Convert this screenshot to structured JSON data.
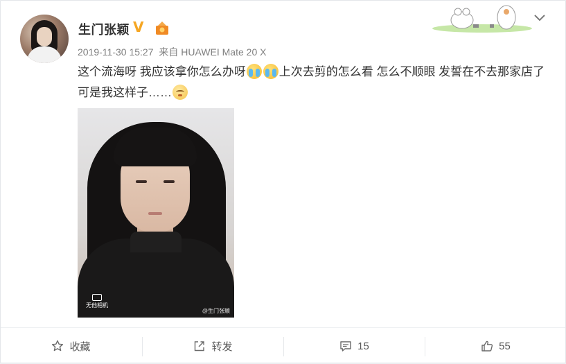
{
  "post": {
    "username": "生门张颖",
    "verified_mark": "V",
    "timestamp": "2019-11-30 15:27",
    "source": "来自 HUAWEI Mate 20 X",
    "text_part1": "这个流海呀 我应该拿你怎么办呀",
    "text_part2": "上次去剪的怎么看 怎么不顺眼 发誓在不去那家店了 可是我这样子……",
    "emojis": [
      "cry-emoji",
      "cry-emoji",
      "dizzy-emoji"
    ],
    "photo_camera_label": "无他相机",
    "photo_watermark": "@生门张颖"
  },
  "actions": {
    "favorite_label": "收藏",
    "repost_label": "转发",
    "comment_count": "15",
    "like_count": "55"
  },
  "colors": {
    "verified": "#f5a623",
    "meta_gray": "#808080",
    "text": "#333333"
  },
  "icons": {
    "favorite": "star-icon",
    "repost": "share-icon",
    "comment": "comment-icon",
    "like": "thumbs-up-icon",
    "menu": "chevron-down-icon"
  }
}
